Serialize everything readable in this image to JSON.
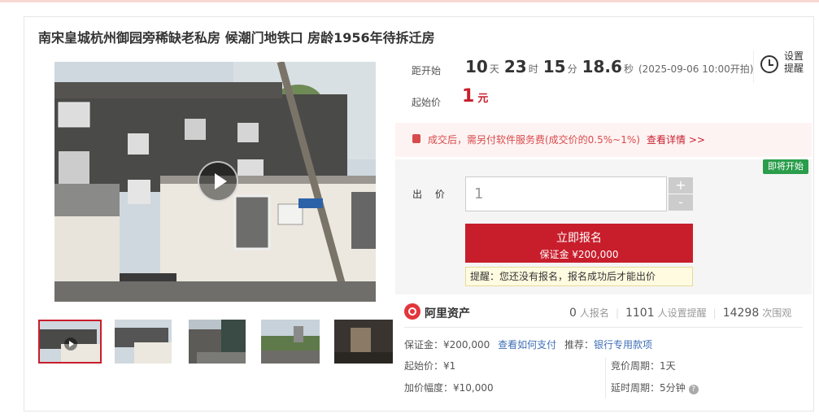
{
  "title": "南宋皇城杭州御园旁稀缺老私房 候潮门地铁口 房龄1956年待拆迁房",
  "countdown": {
    "label": "距开始",
    "days": "10",
    "days_unit": "天",
    "hours": "23",
    "hours_unit": "时",
    "minutes": "15",
    "minutes_unit": "分",
    "seconds": "18.6",
    "seconds_unit": "秒",
    "start_time": "(2025-09-06 10:00开拍)"
  },
  "remind": {
    "label": "设置提醒",
    "icon": "alarm-clock-icon"
  },
  "start_price": {
    "label": "起始价",
    "value": "1",
    "unit": "元"
  },
  "notice": {
    "text": "成交后，需另付软件服务费(成交价的0.5%~1%)",
    "link": "查看详情 >>",
    "icon": "gift-icon"
  },
  "status_badge": "即将开始",
  "bid": {
    "label": "出 价",
    "value": "1",
    "plus": "+",
    "minus": "-"
  },
  "signup": {
    "label": "立即报名",
    "deposit": "保证金 ¥200,000"
  },
  "tip": "提醒：您还没有报名，报名成功后才能出价",
  "brand": "阿里资产",
  "stats": {
    "signups": "0",
    "signups_label": "人报名",
    "reminders": "1101",
    "reminders_label": "人设置提醒",
    "views": "14298",
    "views_label": "次围观"
  },
  "details": {
    "deposit": "保证金：¥200,000",
    "how_to_pay": "查看如何支付",
    "recommend_label": "推荐：",
    "recommend_link": "银行专用款项",
    "start_price": "起始价：¥1",
    "increment": "加价幅度：¥10,000",
    "cycle": "竞价周期：1天",
    "delay": "延时周期：5分钟"
  },
  "colors": {
    "accent": "#c81e2c",
    "badge": "#2a9d4b",
    "link": "#3f6fb6"
  }
}
